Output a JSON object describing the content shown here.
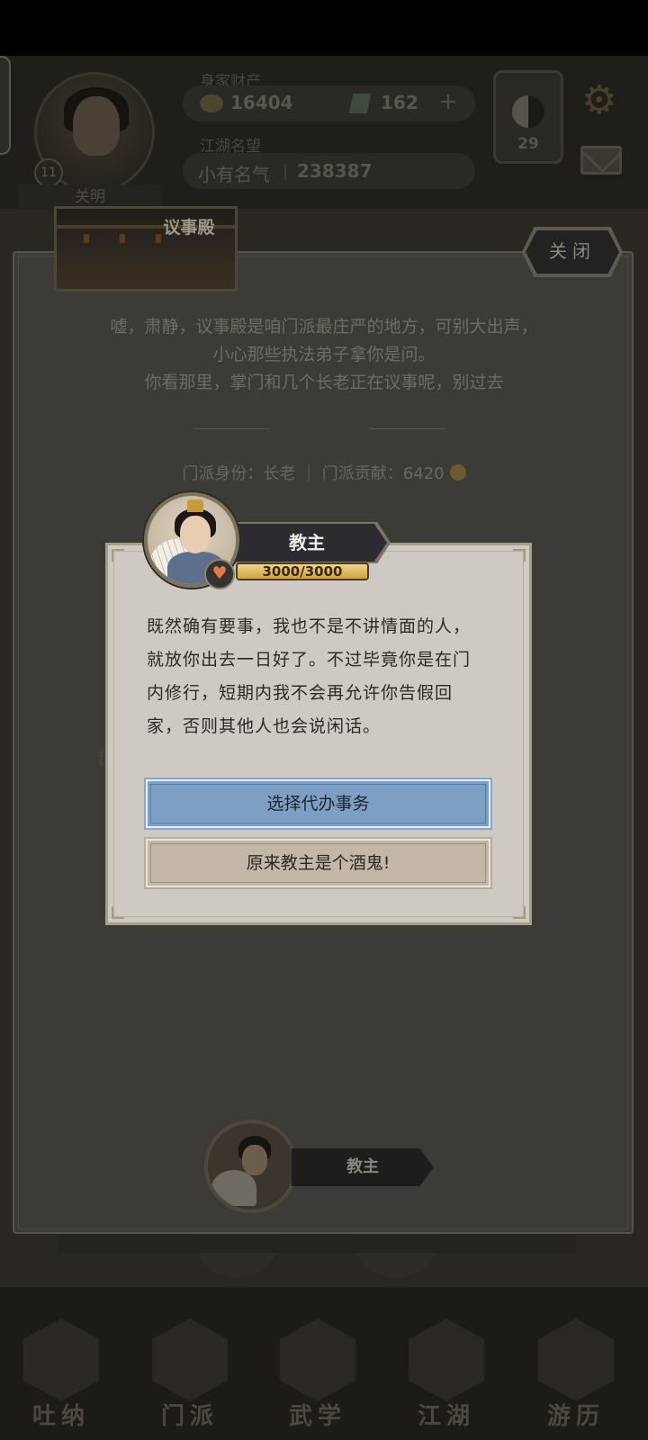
{
  "header": {
    "assets_label": "身家财产",
    "gold": "16404",
    "jade": "162",
    "plus": "+",
    "fame_label": "江湖名望",
    "fame_title": "小有名气",
    "fame_value": "238387",
    "taiji_count": "29",
    "player_level": "11",
    "player_name": "关明"
  },
  "hall": {
    "title": "议事殿",
    "close_label": "关闭",
    "description": [
      "嘘，肃静，议事殿是咱门派最庄严的地方，可别大出声，",
      "小心那些执法弟子拿你是问。",
      "你看那里，掌门和几个长老正在议事呢，别过去"
    ],
    "sect_info": "门派身份：长老 ｜ 门派贡献：6420",
    "hidden_text": "事",
    "npc_name": "教主"
  },
  "dialog": {
    "npc_name": "教主",
    "favor": "3000/3000",
    "favor_fraction": 1.0,
    "text_lines": [
      "既然确有要事，我也不是不讲情面的人，",
      "就放你出去一日好了。不过毕竟你是在门",
      "内修行，短期内我不会再允许你告假回",
      "家，否则其他人也会说闲话。"
    ],
    "choices": [
      {
        "label": "选择代办事务"
      },
      {
        "label": "原来教主是个酒鬼!"
      }
    ],
    "heart_icon": "♥"
  },
  "nav": {
    "items": [
      "吐纳",
      "门派",
      "武学",
      "江湖",
      "游历"
    ]
  },
  "icons": {
    "gear": "⚙"
  },
  "colors": {
    "primary_choice": "#7d9fc3",
    "secondary_choice": "#c3b8a7",
    "dialog_bg": "#cfc9c4",
    "favor_gold": "#c89a44"
  }
}
